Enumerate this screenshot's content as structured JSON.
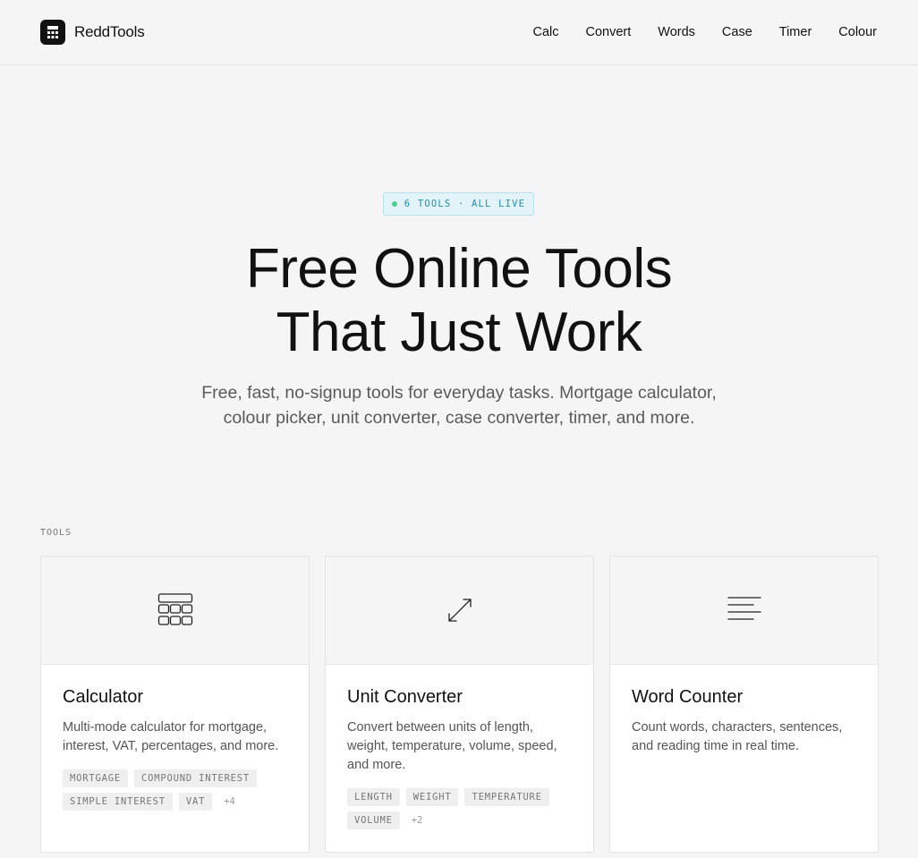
{
  "header": {
    "brand": "ReddTools",
    "nav": [
      "Calc",
      "Convert",
      "Words",
      "Case",
      "Timer",
      "Colour"
    ]
  },
  "hero": {
    "badge": "6 TOOLS · ALL LIVE",
    "title_line1": "Free Online Tools",
    "title_line2": "That Just Work",
    "subtitle": "Free, fast, no-signup tools for everyday tasks. Mortgage calculator, colour picker, unit converter, case converter, timer, and more."
  },
  "tools_section": {
    "label": "TOOLS",
    "cards": [
      {
        "icon": "calculator-icon",
        "title": "Calculator",
        "description": "Multi-mode calculator for mortgage, interest, VAT, percentages, and more.",
        "tags": [
          "MORTGAGE",
          "COMPOUND INTEREST",
          "SIMPLE INTEREST",
          "VAT"
        ],
        "more": "+4"
      },
      {
        "icon": "resize-arrows-icon",
        "title": "Unit Converter",
        "description": "Convert between units of length, weight, temperature, volume, speed, and more.",
        "tags": [
          "LENGTH",
          "WEIGHT",
          "TEMPERATURE",
          "VOLUME"
        ],
        "more": "+2"
      },
      {
        "icon": "text-lines-icon",
        "title": "Word Counter",
        "description": "Count words, characters, sentences, and reading time in real time.",
        "tags": [],
        "more": ""
      }
    ]
  },
  "colors": {
    "background": "#f5f5f5",
    "badge_bg": "#e3f3fa",
    "badge_text": "#1f8fb0",
    "status_dot": "#4cd18a"
  }
}
